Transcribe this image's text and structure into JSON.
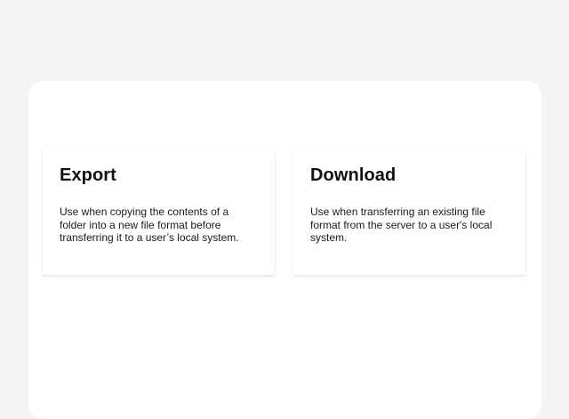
{
  "cards": [
    {
      "title": "Export",
      "description": "Use when copying the contents of a folder into a new file format before transferring it to a user’s local system."
    },
    {
      "title": "Download",
      "description": "Use when transferring an existing file format from the server to a user's local system."
    }
  ]
}
